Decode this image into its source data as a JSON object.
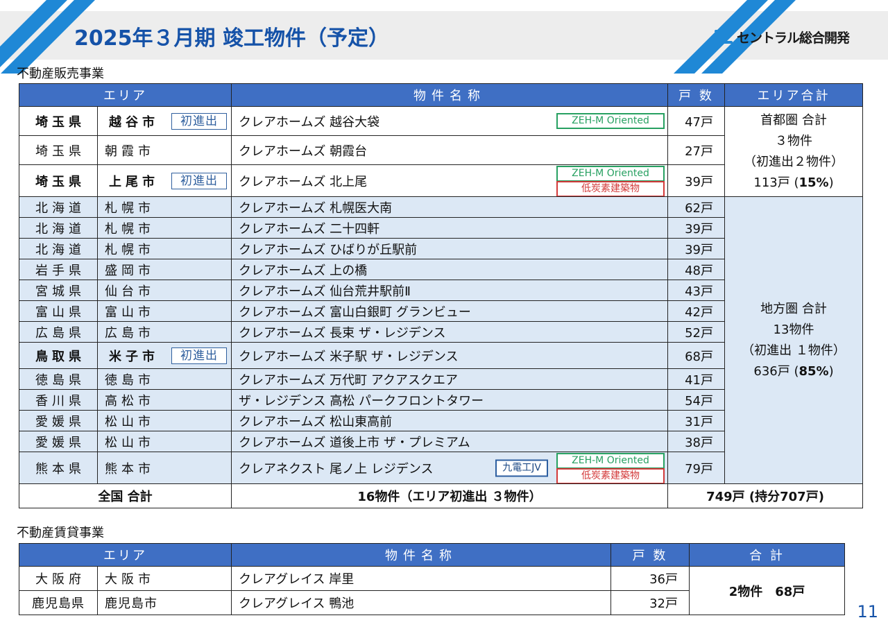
{
  "header": {
    "title": "2025年３月期  竣工物件（予定）",
    "logo_text": "セントラル総合開発"
  },
  "sales": {
    "section_label": "不動産販売事業",
    "headers": {
      "area": "エリア",
      "name": "物件名称",
      "units": "戸 数",
      "area_total": "エリア合計"
    },
    "rows": [
      {
        "pref": "埼玉県",
        "city": "越谷市",
        "first": "初進出",
        "name": "クレアホームズ 越谷大袋",
        "zeh": "ZEH-M Oriented",
        "units": "47戸"
      },
      {
        "pref": "埼玉県",
        "city": "朝霞市",
        "name": "クレアホームズ 朝霞台",
        "units": "27戸"
      },
      {
        "pref": "埼玉県",
        "city": "上尾市",
        "first": "初進出",
        "name": "クレアホームズ 北上尾",
        "zeh": "ZEH-M Oriented",
        "lowcarbon": "低炭素建築物",
        "units": "39戸"
      },
      {
        "pref": "北海道",
        "city": "札幌市",
        "name": "クレアホームズ 札幌医大南",
        "units": "62戸"
      },
      {
        "pref": "北海道",
        "city": "札幌市",
        "name": "クレアホームズ 二十四軒",
        "units": "39戸"
      },
      {
        "pref": "北海道",
        "city": "札幌市",
        "name": "クレアホームズ ひばりが丘駅前",
        "units": "39戸"
      },
      {
        "pref": "岩手県",
        "city": "盛岡市",
        "name": "クレアホームズ 上の橋",
        "units": "48戸"
      },
      {
        "pref": "宮城県",
        "city": "仙台市",
        "name": "クレアホームズ 仙台荒井駅前Ⅱ",
        "units": "43戸"
      },
      {
        "pref": "富山県",
        "city": "富山市",
        "name": "クレアホームズ 富山白銀町 グランビュー",
        "units": "42戸"
      },
      {
        "pref": "広島県",
        "city": "広島市",
        "name": "クレアホームズ 長束 ザ・レジデンス",
        "units": "52戸"
      },
      {
        "pref": "鳥取県",
        "city": "米子市",
        "first": "初進出",
        "name": "クレアホームズ 米子駅 ザ・レジデンス",
        "units": "68戸"
      },
      {
        "pref": "徳島県",
        "city": "徳島市",
        "name": "クレアホームズ 万代町 アクアスクエア",
        "units": "41戸"
      },
      {
        "pref": "香川県",
        "city": "高松市",
        "name": "ザ・レジデンス 高松 パークフロントタワー",
        "units": "54戸"
      },
      {
        "pref": "愛媛県",
        "city": "松山市",
        "name": "クレアホームズ 松山東高前",
        "units": "31戸"
      },
      {
        "pref": "愛媛県",
        "city": "松山市",
        "name": "クレアホームズ 道後上市 ザ・プレミアム",
        "units": "38戸"
      },
      {
        "pref": "熊本県",
        "city": "熊本市",
        "name": "クレアネクスト 尾ノ上 レジデンス",
        "jv": "九電工JV",
        "zeh": "ZEH-M Oriented",
        "lowcarbon": "低炭素建築物",
        "units": "79戸"
      }
    ],
    "metro_total": {
      "l1": "首都圏 合計",
      "l2": "３物件",
      "l3": "（初進出２物件）",
      "l4a": "113戸 (",
      "l4b": "15%",
      "l4c": ")"
    },
    "regional_total": {
      "l1": "地方圏 合計",
      "l2": "13物件",
      "l3": "（初進出 １物件）",
      "l4a": "636戸 (",
      "l4b": "85%",
      "l4c": ")"
    },
    "footer": {
      "label": "全国 合計",
      "properties": "16物件（エリア初進出 ３物件）",
      "units": "749戸 (持分707戸)"
    }
  },
  "leasing": {
    "section_label": "不動産賃貸事業",
    "headers": {
      "area": "エリア",
      "name": "物件名称",
      "units": "戸 数",
      "total": "合 計"
    },
    "rows": [
      {
        "pref": "大阪府",
        "city": "大阪市",
        "name": "クレアグレイス 岸里",
        "units": "36戸"
      },
      {
        "pref": "鹿児島県",
        "city": "鹿児島市",
        "name": "クレアグレイス 鴨池",
        "units": "32戸"
      }
    ],
    "total": "2物件　68戸"
  },
  "page_number": "11",
  "colors": {
    "header_blue": "#3f6fc4",
    "title_blue": "#1552a8",
    "row_light": "#dce8f5",
    "zeh_green": "#27a061",
    "lowcarbon_red": "#d33a3a",
    "accent": "#1f88d6"
  }
}
